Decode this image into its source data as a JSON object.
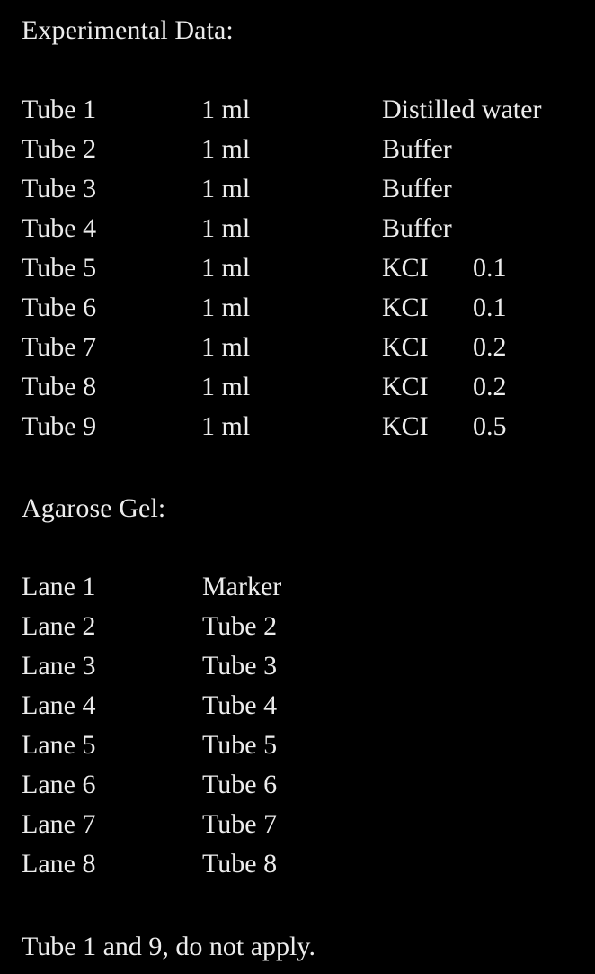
{
  "page": {
    "background_color": "#000000",
    "text_color": "#ececec"
  },
  "experimental_data": {
    "heading": "Experimental Data:",
    "rows": [
      {
        "tube": "Tube 1",
        "volume": "1 ml",
        "substance": "Distilled water",
        "concentration": ""
      },
      {
        "tube": "Tube 2",
        "volume": "1 ml",
        "substance": "Buffer",
        "concentration": ""
      },
      {
        "tube": "Tube 3",
        "volume": "1 ml",
        "substance": "Buffer",
        "concentration": ""
      },
      {
        "tube": "Tube 4",
        "volume": "1 ml",
        "substance": "Buffer",
        "concentration": ""
      },
      {
        "tube": "Tube 5",
        "volume": "1 ml",
        "substance": "KCI",
        "concentration": "0.1"
      },
      {
        "tube": "Tube 6",
        "volume": "1 ml",
        "substance": "KCI",
        "concentration": "0.1"
      },
      {
        "tube": "Tube 7",
        "volume": "1 ml",
        "substance": "KCI",
        "concentration": "0.2"
      },
      {
        "tube": "Tube 8",
        "volume": "1 ml",
        "substance": "KCI",
        "concentration": "0.2"
      },
      {
        "tube": "Tube 9",
        "volume": "1 ml",
        "substance": "KCI",
        "concentration": "0.5"
      }
    ]
  },
  "agarose_gel": {
    "heading": "Agarose Gel:",
    "rows": [
      {
        "lane": "Lane 1",
        "source": "Marker"
      },
      {
        "lane": "Lane 2",
        "source": "Tube 2"
      },
      {
        "lane": "Lane 3",
        "source": "Tube 3"
      },
      {
        "lane": "Lane 4",
        "source": "Tube 4"
      },
      {
        "lane": "Lane 5",
        "source": "Tube 5"
      },
      {
        "lane": "Lane 6",
        "source": "Tube 6"
      },
      {
        "lane": "Lane 7",
        "source": "Tube 7"
      },
      {
        "lane": "Lane 8",
        "source": "Tube 8"
      }
    ]
  },
  "footnote": {
    "text": "Tube 1 and 9, do not apply."
  }
}
